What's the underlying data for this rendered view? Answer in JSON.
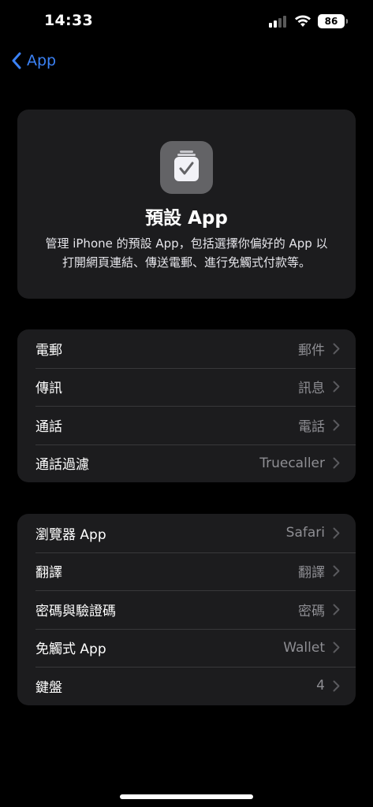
{
  "status": {
    "time": "14:33",
    "battery": "86"
  },
  "nav": {
    "back_label": "App"
  },
  "header": {
    "title": "預設 App",
    "description_line1": "管理 iPhone 的預設 App，包括選擇你偏好的 App 以",
    "description_line2": "打開網頁連結、傳送電郵、進行免觸式付款等。"
  },
  "group1": [
    {
      "label": "電郵",
      "value": "郵件"
    },
    {
      "label": "傳訊",
      "value": "訊息"
    },
    {
      "label": "通話",
      "value": "電話"
    },
    {
      "label": "通話過濾",
      "value": "Truecaller"
    }
  ],
  "group2": [
    {
      "label": "瀏覽器 App",
      "value": "Safari"
    },
    {
      "label": "翻譯",
      "value": "翻譯"
    },
    {
      "label": "密碼與驗證碼",
      "value": "密碼"
    },
    {
      "label": "免觸式 App",
      "value": "Wallet"
    },
    {
      "label": "鍵盤",
      "value": "4"
    }
  ],
  "colors": {
    "accent": "#3b82f6",
    "card": "#1c1c1e",
    "secondary_text": "#8e8e93"
  },
  "icons": [
    "chevron-left-icon",
    "chevron-right-icon",
    "signal-icon",
    "wifi-icon",
    "battery-icon",
    "default-apps-icon"
  ]
}
